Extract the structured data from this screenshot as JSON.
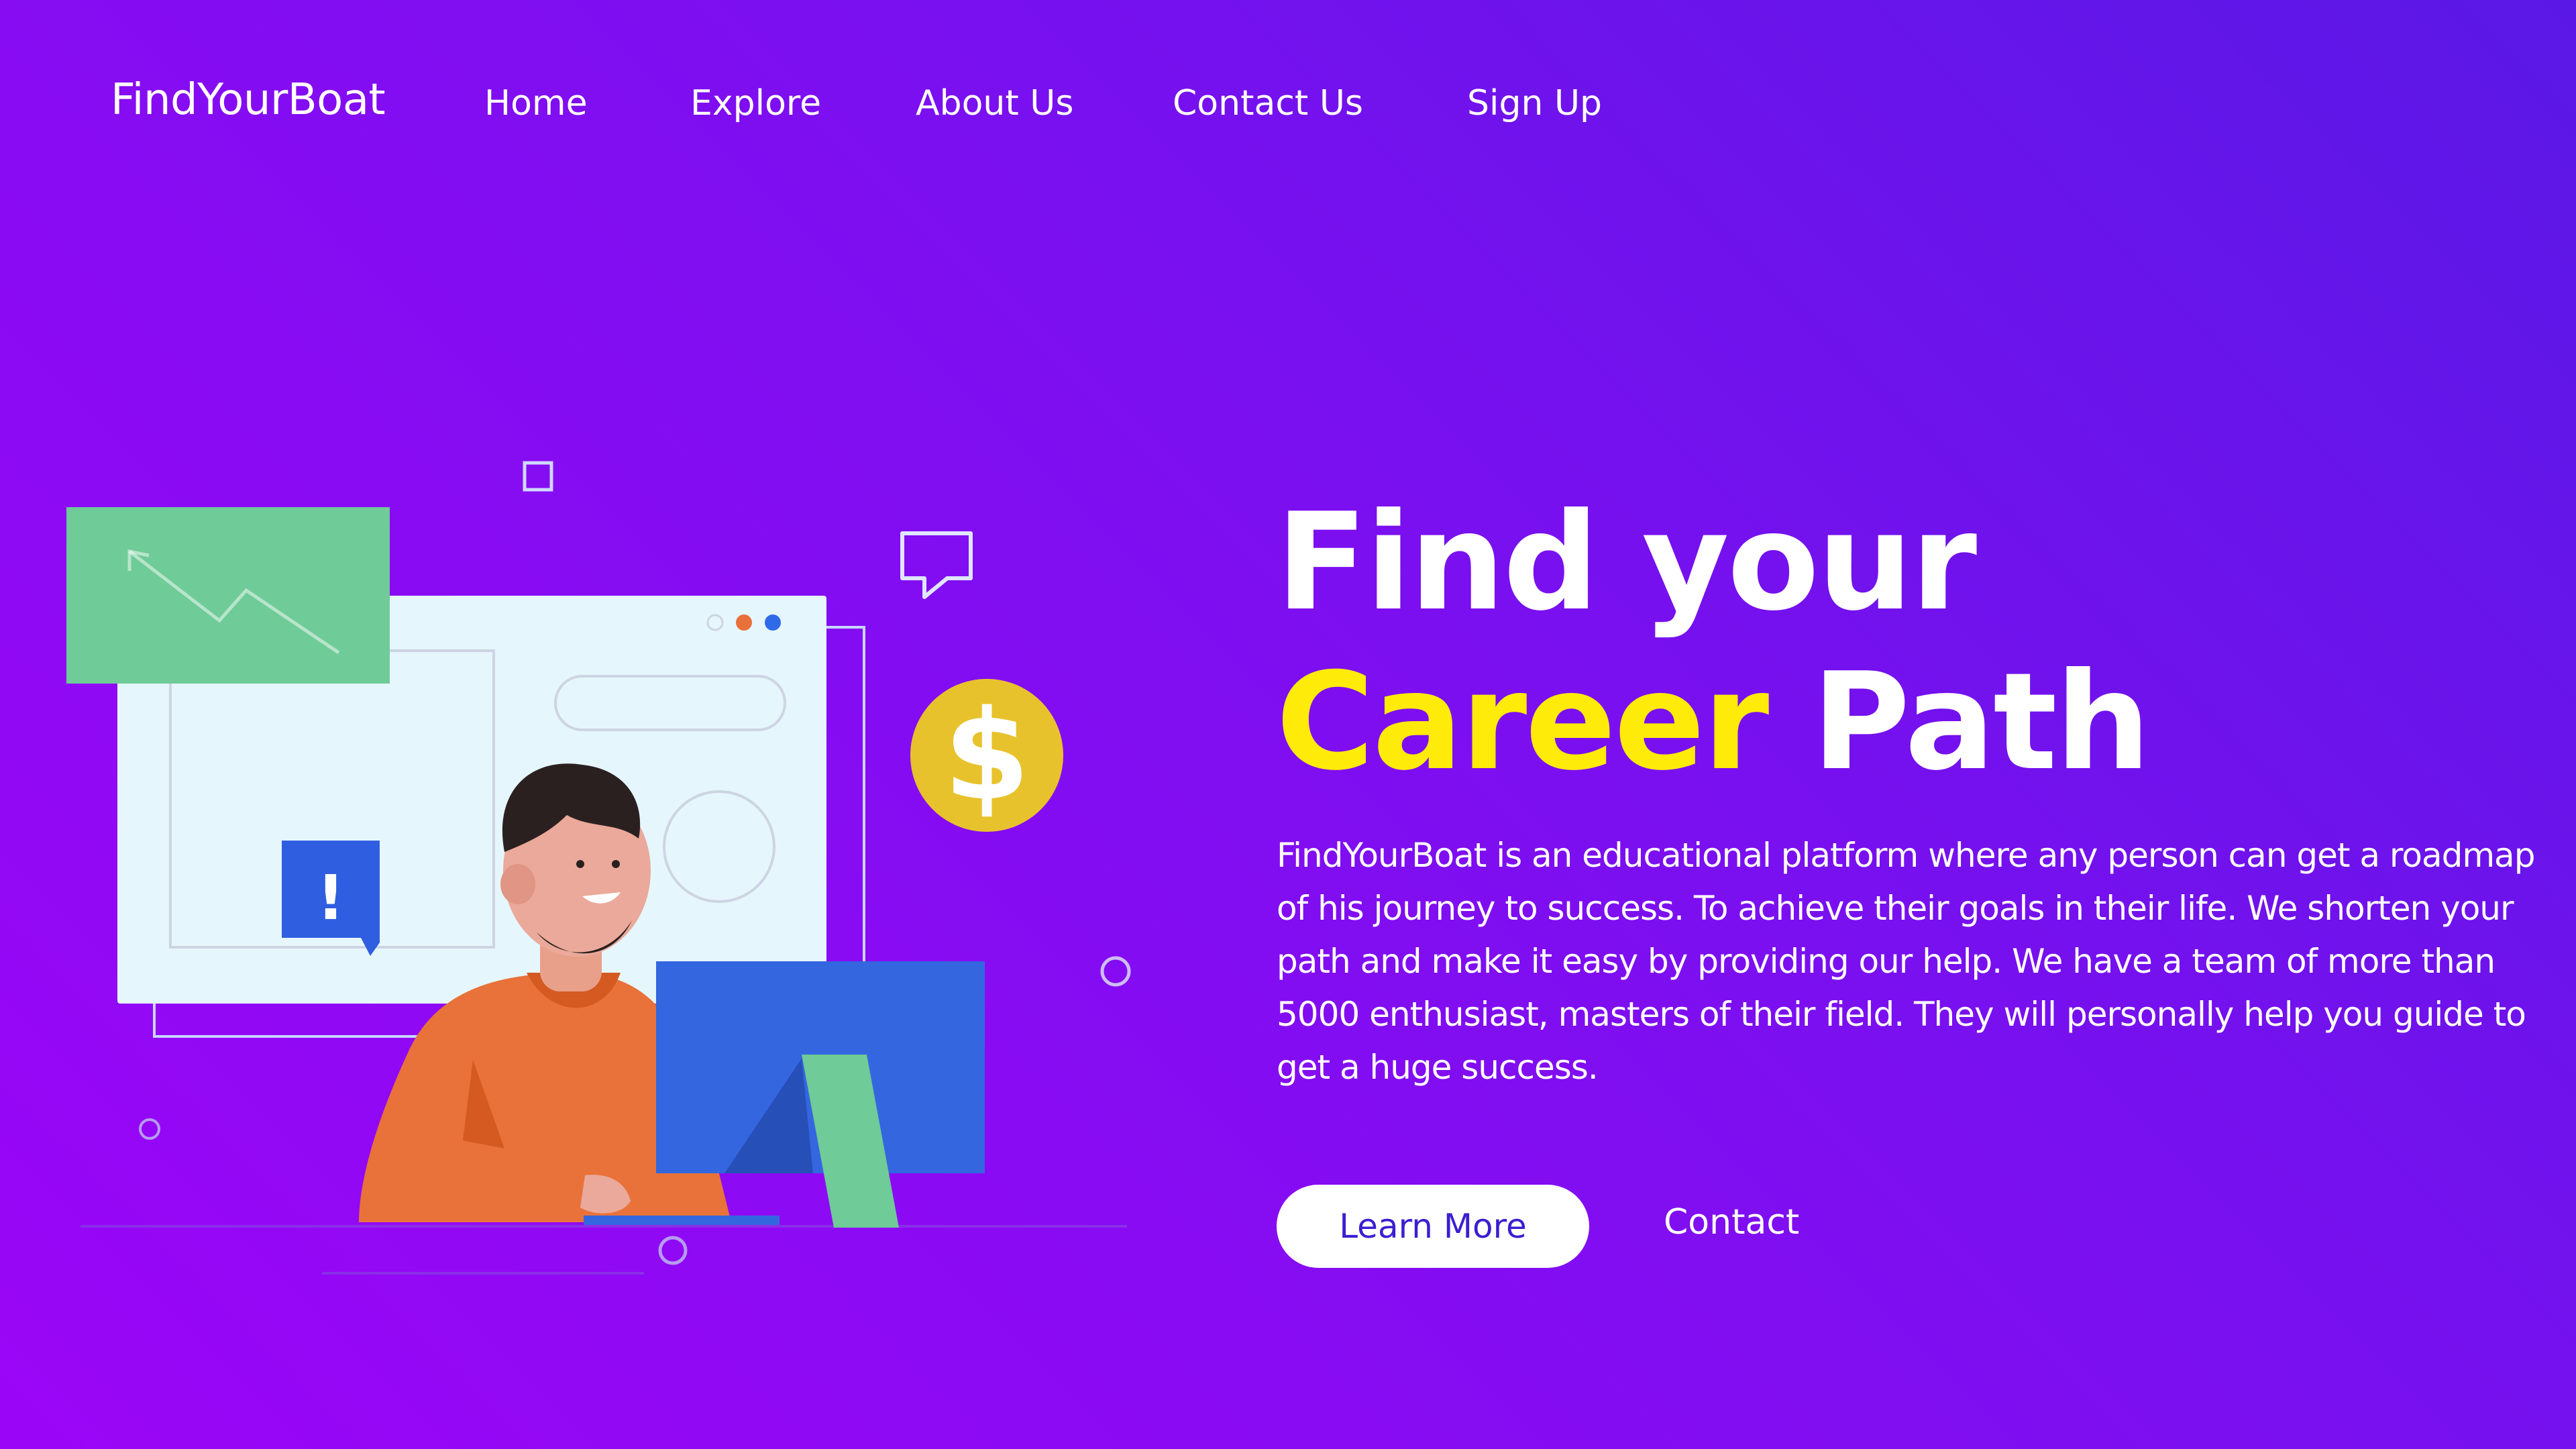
{
  "nav": {
    "logo": "FindYourBoat",
    "links": [
      "Home",
      "Explore",
      "About Us",
      "Contact Us",
      "Sign Up"
    ]
  },
  "hero": {
    "title_line1": "Find your",
    "title_accent": "Career",
    "title_rest": "Path",
    "description": "FindYourBoat is an educational platform where any person can get a roadmap of his journey to success. To achieve their goals in their life. We shorten your path and make it easy by providing our help. We have a team of more than 5000 enthusiast, masters of their field. They will personally help you guide to get a huge success.",
    "primary_button": "Learn More",
    "secondary_button": "Contact"
  },
  "illustration": {
    "coin_symbol": "$",
    "alert_symbol": "!"
  },
  "colors": {
    "accent_yellow": "#ffeb0a",
    "button_text": "#3c1ed2",
    "bg_start": "#9b05f7",
    "bg_end": "#5a18e6"
  }
}
